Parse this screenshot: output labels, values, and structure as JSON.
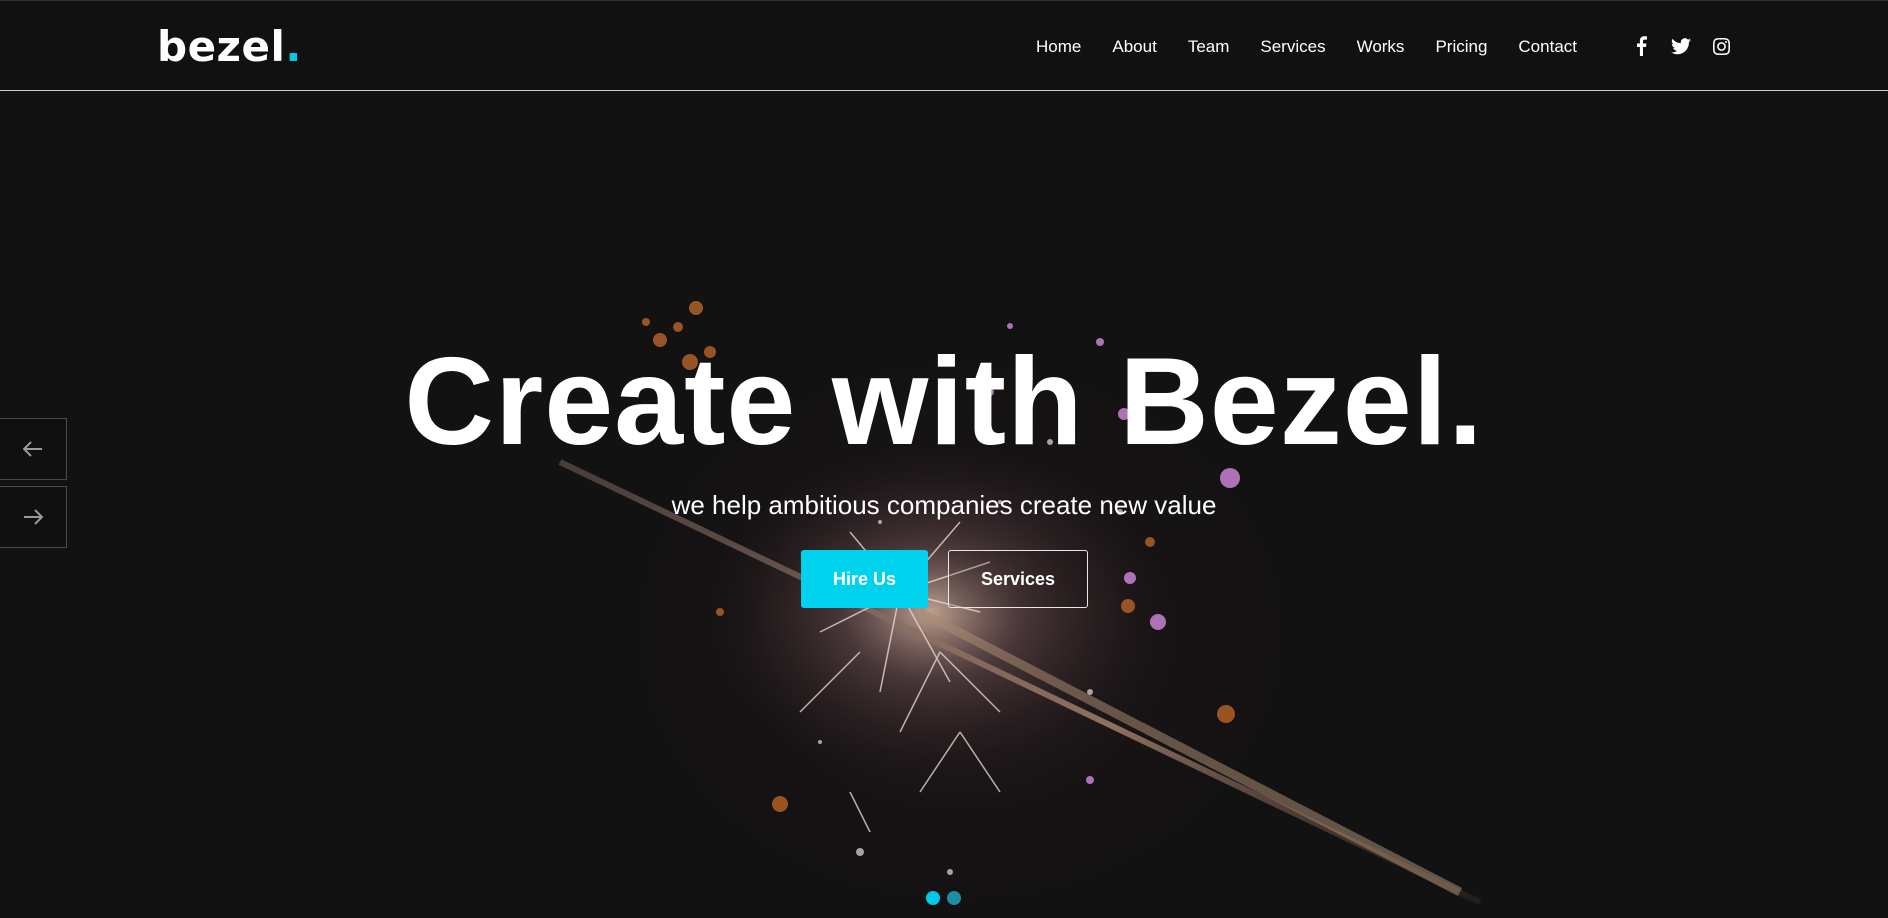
{
  "brand": {
    "name": "bezel",
    "dot": ".",
    "accent_color": "#00c8e8"
  },
  "nav": {
    "items": [
      {
        "label": "Home"
      },
      {
        "label": "About"
      },
      {
        "label": "Team"
      },
      {
        "label": "Services"
      },
      {
        "label": "Works"
      },
      {
        "label": "Pricing"
      },
      {
        "label": "Contact"
      }
    ]
  },
  "social": {
    "icons": [
      "facebook-icon",
      "twitter-icon",
      "instagram-icon"
    ]
  },
  "hero": {
    "headline": "Create with Bezel.",
    "subline": "we help ambitious companies create new value",
    "primary_button": "Hire Us",
    "secondary_button": "Services",
    "prev_icon": "arrow-left-icon",
    "next_icon": "arrow-right-icon",
    "slides": {
      "count": 2,
      "active": 1
    }
  },
  "colors": {
    "background": "#121212",
    "primary_button": "#00d2ee",
    "text": "#ffffff"
  }
}
